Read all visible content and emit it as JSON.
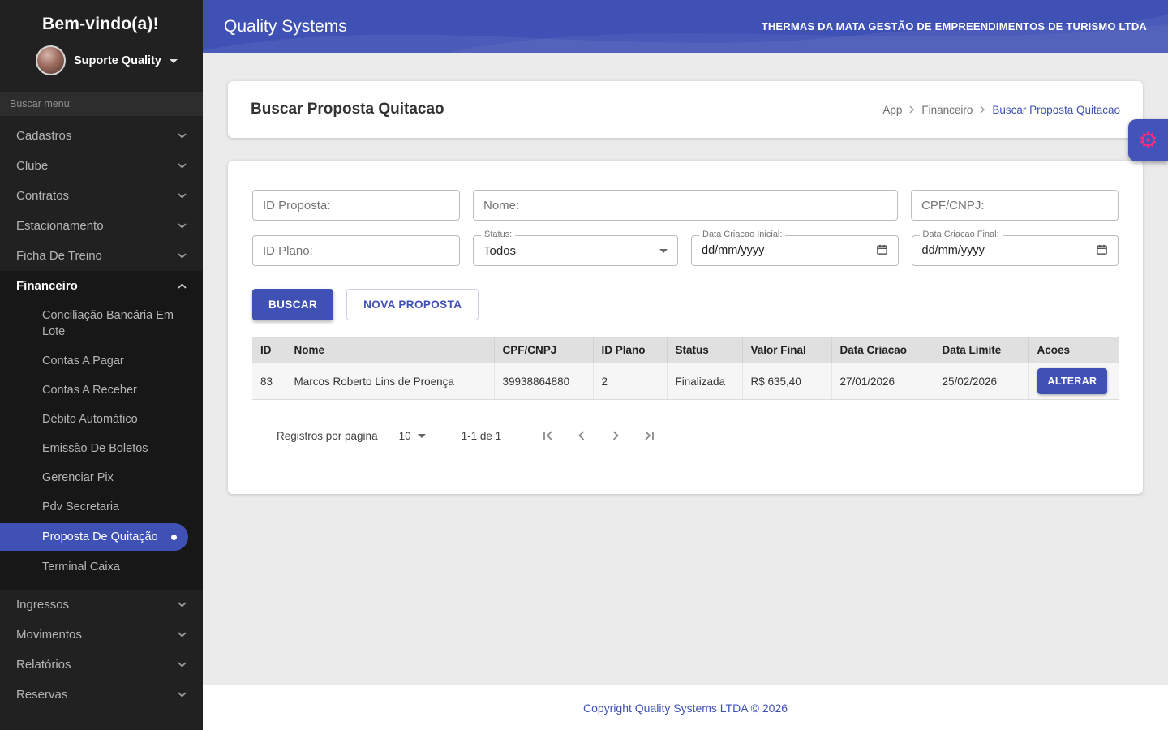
{
  "colors": {
    "accent": "#3f51b5",
    "sidebar_bg": "#212121",
    "header_bg": "#3f51b5",
    "fab_icon": "#ff2a7f",
    "table_header_bg": "#e0e0e0"
  },
  "sidebar": {
    "welcome": "Bem-vindo(a)!",
    "user_name": "Suporte Quality",
    "search_placeholder": "Buscar menu:",
    "items": [
      {
        "label": "Cadastros"
      },
      {
        "label": "Clube"
      },
      {
        "label": "Contratos"
      },
      {
        "label": "Estacionamento"
      },
      {
        "label": "Ficha De Treino"
      }
    ],
    "financeiro": {
      "label": "Financeiro",
      "submenu": [
        "Conciliação Bancária Em Lote",
        "Contas A Pagar",
        "Contas A Receber",
        "Débito Automático",
        "Emissão De Boletos",
        "Gerenciar Pix",
        "Pdv Secretaria",
        "Proposta De Quitação",
        "Terminal Caixa"
      ]
    },
    "items_bottom": [
      {
        "label": "Ingressos"
      },
      {
        "label": "Movimentos"
      },
      {
        "label": "Relatórios"
      },
      {
        "label": "Reservas"
      }
    ]
  },
  "header": {
    "app_title": "Quality Systems",
    "company": "THERMAS DA MATA GESTÃO DE EMPREENDIMENTOS DE TURISMO LTDA"
  },
  "page": {
    "title": "Buscar Proposta Quitacao",
    "breadcrumb": {
      "app": "App",
      "section": "Financeiro",
      "current": "Buscar Proposta Quitacao"
    }
  },
  "form": {
    "id_proposta_placeholder": "ID Proposta:",
    "nome_placeholder": "Nome:",
    "cpf_placeholder": "CPF/CNPJ:",
    "id_plano_placeholder": "ID Plano:",
    "status_label": "Status:",
    "status_value": "Todos",
    "data_inicial_label": "Data Criacao Inicial:",
    "data_final_label": "Data Criacao Final:",
    "date_placeholder": "dd/mm/yyyy"
  },
  "actions": {
    "buscar": "BUSCAR",
    "nova_proposta": "NOVA PROPOSTA"
  },
  "table": {
    "headers": [
      "ID",
      "Nome",
      "CPF/CNPJ",
      "ID Plano",
      "Status",
      "Valor Final",
      "Data Criacao",
      "Data Limite",
      "Acoes"
    ],
    "rows": [
      {
        "id": "83",
        "nome": "Marcos Roberto Lins de Proença",
        "cpf_cnpj": "39938864880",
        "id_plano": "2",
        "status": "Finalizada",
        "valor_final": "R$ 635,40",
        "data_criacao": "27/01/2026",
        "data_limite": "25/02/2026",
        "action": "ALTERAR"
      }
    ]
  },
  "pagination": {
    "label": "Registros por pagina",
    "per_page": "10",
    "range": "1-1 de 1"
  },
  "footer": {
    "copyright": "Copyright Quality Systems LTDA © 2026"
  }
}
